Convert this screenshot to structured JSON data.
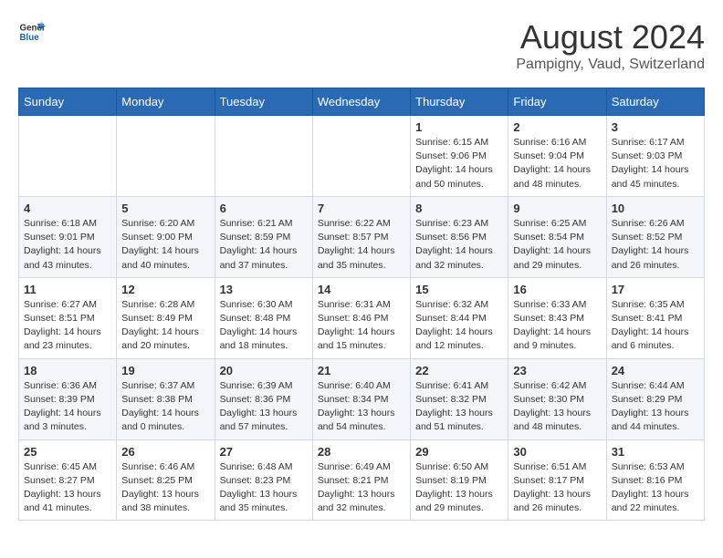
{
  "logo": {
    "line1": "General",
    "line2": "Blue"
  },
  "title": "August 2024",
  "subtitle": "Pampigny, Vaud, Switzerland",
  "days_header": [
    "Sunday",
    "Monday",
    "Tuesday",
    "Wednesday",
    "Thursday",
    "Friday",
    "Saturday"
  ],
  "weeks": [
    [
      {
        "num": "",
        "info": ""
      },
      {
        "num": "",
        "info": ""
      },
      {
        "num": "",
        "info": ""
      },
      {
        "num": "",
        "info": ""
      },
      {
        "num": "1",
        "info": "Sunrise: 6:15 AM\nSunset: 9:06 PM\nDaylight: 14 hours\nand 50 minutes."
      },
      {
        "num": "2",
        "info": "Sunrise: 6:16 AM\nSunset: 9:04 PM\nDaylight: 14 hours\nand 48 minutes."
      },
      {
        "num": "3",
        "info": "Sunrise: 6:17 AM\nSunset: 9:03 PM\nDaylight: 14 hours\nand 45 minutes."
      }
    ],
    [
      {
        "num": "4",
        "info": "Sunrise: 6:18 AM\nSunset: 9:01 PM\nDaylight: 14 hours\nand 43 minutes."
      },
      {
        "num": "5",
        "info": "Sunrise: 6:20 AM\nSunset: 9:00 PM\nDaylight: 14 hours\nand 40 minutes."
      },
      {
        "num": "6",
        "info": "Sunrise: 6:21 AM\nSunset: 8:59 PM\nDaylight: 14 hours\nand 37 minutes."
      },
      {
        "num": "7",
        "info": "Sunrise: 6:22 AM\nSunset: 8:57 PM\nDaylight: 14 hours\nand 35 minutes."
      },
      {
        "num": "8",
        "info": "Sunrise: 6:23 AM\nSunset: 8:56 PM\nDaylight: 14 hours\nand 32 minutes."
      },
      {
        "num": "9",
        "info": "Sunrise: 6:25 AM\nSunset: 8:54 PM\nDaylight: 14 hours\nand 29 minutes."
      },
      {
        "num": "10",
        "info": "Sunrise: 6:26 AM\nSunset: 8:52 PM\nDaylight: 14 hours\nand 26 minutes."
      }
    ],
    [
      {
        "num": "11",
        "info": "Sunrise: 6:27 AM\nSunset: 8:51 PM\nDaylight: 14 hours\nand 23 minutes."
      },
      {
        "num": "12",
        "info": "Sunrise: 6:28 AM\nSunset: 8:49 PM\nDaylight: 14 hours\nand 20 minutes."
      },
      {
        "num": "13",
        "info": "Sunrise: 6:30 AM\nSunset: 8:48 PM\nDaylight: 14 hours\nand 18 minutes."
      },
      {
        "num": "14",
        "info": "Sunrise: 6:31 AM\nSunset: 8:46 PM\nDaylight: 14 hours\nand 15 minutes."
      },
      {
        "num": "15",
        "info": "Sunrise: 6:32 AM\nSunset: 8:44 PM\nDaylight: 14 hours\nand 12 minutes."
      },
      {
        "num": "16",
        "info": "Sunrise: 6:33 AM\nSunset: 8:43 PM\nDaylight: 14 hours\nand 9 minutes."
      },
      {
        "num": "17",
        "info": "Sunrise: 6:35 AM\nSunset: 8:41 PM\nDaylight: 14 hours\nand 6 minutes."
      }
    ],
    [
      {
        "num": "18",
        "info": "Sunrise: 6:36 AM\nSunset: 8:39 PM\nDaylight: 14 hours\nand 3 minutes."
      },
      {
        "num": "19",
        "info": "Sunrise: 6:37 AM\nSunset: 8:38 PM\nDaylight: 14 hours\nand 0 minutes."
      },
      {
        "num": "20",
        "info": "Sunrise: 6:39 AM\nSunset: 8:36 PM\nDaylight: 13 hours\nand 57 minutes."
      },
      {
        "num": "21",
        "info": "Sunrise: 6:40 AM\nSunset: 8:34 PM\nDaylight: 13 hours\nand 54 minutes."
      },
      {
        "num": "22",
        "info": "Sunrise: 6:41 AM\nSunset: 8:32 PM\nDaylight: 13 hours\nand 51 minutes."
      },
      {
        "num": "23",
        "info": "Sunrise: 6:42 AM\nSunset: 8:30 PM\nDaylight: 13 hours\nand 48 minutes."
      },
      {
        "num": "24",
        "info": "Sunrise: 6:44 AM\nSunset: 8:29 PM\nDaylight: 13 hours\nand 44 minutes."
      }
    ],
    [
      {
        "num": "25",
        "info": "Sunrise: 6:45 AM\nSunset: 8:27 PM\nDaylight: 13 hours\nand 41 minutes."
      },
      {
        "num": "26",
        "info": "Sunrise: 6:46 AM\nSunset: 8:25 PM\nDaylight: 13 hours\nand 38 minutes."
      },
      {
        "num": "27",
        "info": "Sunrise: 6:48 AM\nSunset: 8:23 PM\nDaylight: 13 hours\nand 35 minutes."
      },
      {
        "num": "28",
        "info": "Sunrise: 6:49 AM\nSunset: 8:21 PM\nDaylight: 13 hours\nand 32 minutes."
      },
      {
        "num": "29",
        "info": "Sunrise: 6:50 AM\nSunset: 8:19 PM\nDaylight: 13 hours\nand 29 minutes."
      },
      {
        "num": "30",
        "info": "Sunrise: 6:51 AM\nSunset: 8:17 PM\nDaylight: 13 hours\nand 26 minutes."
      },
      {
        "num": "31",
        "info": "Sunrise: 6:53 AM\nSunset: 8:16 PM\nDaylight: 13 hours\nand 22 minutes."
      }
    ]
  ]
}
